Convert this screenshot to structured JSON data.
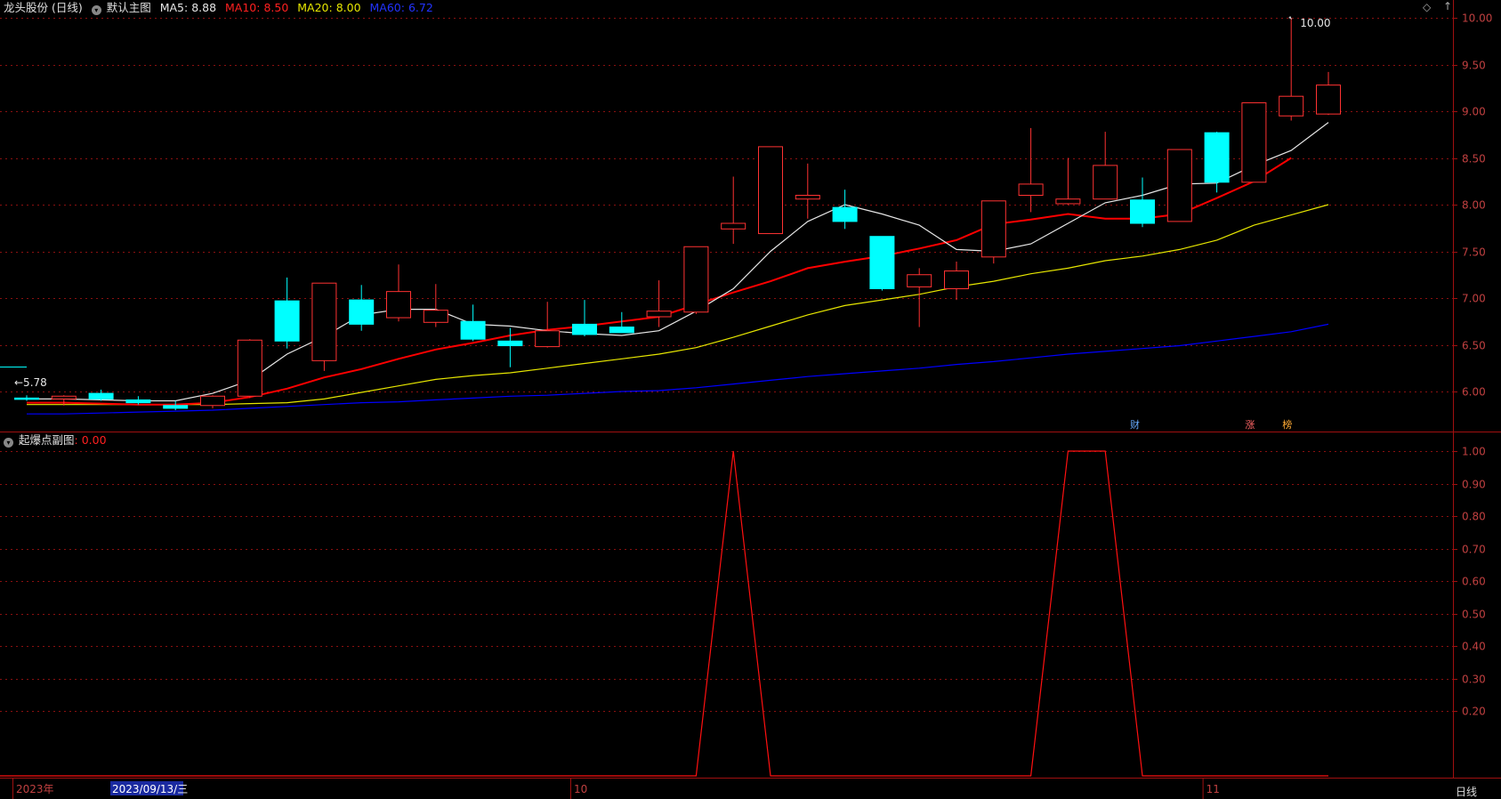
{
  "header": {
    "stock_name": "龙头股份 (日线)",
    "main_chart_label": "默认主图",
    "ma5": "MA5: 8.88",
    "ma10": "MA10: 8.50",
    "ma20": "MA20: 8.00",
    "ma60": "MA60: 6.72",
    "settings_icon": "diamond-icon"
  },
  "sub_header": {
    "label": "起爆点副图",
    "value": ": 0.00"
  },
  "colors": {
    "bg": "#000000",
    "up": "#ff3232",
    "down": "#00ffff",
    "ma5": "#e6e6e6",
    "ma10": "#ff0000",
    "ma20": "#e6e600",
    "ma60": "#0000ff",
    "grid": "#8a1010",
    "axis_text": "#c04040",
    "sub_line": "#ff1010"
  },
  "chart_data": [
    {
      "type": "candlestick",
      "ylim": [
        5.55,
        10.2
      ],
      "y_ticks": [
        "10.00",
        "9.50",
        "9.00",
        "8.50",
        "8.00",
        "7.50",
        "7.00",
        "6.50",
        "6.00"
      ],
      "ohlc": [
        [
          5.93,
          5.96,
          5.9,
          5.92
        ],
        [
          5.92,
          5.96,
          5.85,
          5.95
        ],
        [
          5.98,
          6.02,
          5.9,
          5.92
        ],
        [
          5.91,
          5.95,
          5.86,
          5.88
        ],
        [
          5.85,
          5.9,
          5.8,
          5.82
        ],
        [
          5.85,
          5.96,
          5.82,
          5.95
        ],
        [
          5.95,
          6.56,
          5.93,
          6.55
        ],
        [
          6.97,
          7.22,
          6.46,
          6.54
        ],
        [
          6.33,
          7.16,
          6.22,
          7.16
        ],
        [
          6.98,
          7.14,
          6.65,
          6.72
        ],
        [
          6.79,
          7.36,
          6.75,
          7.07
        ],
        [
          6.74,
          7.15,
          6.69,
          6.87
        ],
        [
          6.75,
          6.93,
          6.54,
          6.56
        ],
        [
          6.54,
          6.68,
          6.26,
          6.49
        ],
        [
          6.48,
          6.96,
          6.47,
          6.65
        ],
        [
          6.72,
          6.98,
          6.59,
          6.61
        ],
        [
          6.69,
          6.85,
          6.65,
          6.63
        ],
        [
          6.8,
          7.19,
          6.69,
          6.86
        ],
        [
          6.85,
          7.55,
          6.83,
          7.55
        ],
        [
          7.74,
          8.3,
          7.58,
          7.8
        ],
        [
          7.69,
          8.62,
          7.69,
          8.62
        ],
        [
          8.06,
          8.44,
          7.85,
          8.1
        ],
        [
          7.97,
          8.16,
          7.74,
          7.82
        ],
        [
          7.66,
          7.66,
          7.08,
          7.1
        ],
        [
          7.12,
          7.32,
          6.69,
          7.25
        ],
        [
          7.1,
          7.39,
          6.98,
          7.29
        ],
        [
          7.44,
          8.04,
          7.37,
          8.04
        ],
        [
          8.1,
          8.82,
          7.92,
          8.22
        ],
        [
          8.01,
          8.5,
          8.0,
          8.06
        ],
        [
          8.06,
          8.78,
          8.06,
          8.42
        ],
        [
          8.05,
          8.29,
          7.76,
          7.8
        ],
        [
          7.82,
          8.59,
          7.82,
          8.59
        ],
        [
          8.77,
          8.78,
          8.13,
          8.24
        ],
        [
          8.24,
          9.07,
          8.24,
          9.09
        ],
        [
          8.95,
          10.0,
          8.9,
          9.16
        ],
        [
          8.97,
          9.42,
          8.96,
          9.28
        ]
      ],
      "ma5": [
        5.92,
        5.92,
        5.91,
        5.9,
        5.9,
        5.98,
        6.12,
        6.4,
        6.59,
        6.82,
        6.88,
        6.88,
        6.72,
        6.7,
        6.65,
        6.62,
        6.6,
        6.65,
        6.86,
        7.1,
        7.5,
        7.82,
        8.0,
        7.9,
        7.78,
        7.52,
        7.5,
        7.58,
        7.8,
        8.02,
        8.1,
        8.22,
        8.23,
        8.42,
        8.58,
        8.88
      ],
      "ma10": [
        5.88,
        5.88,
        5.87,
        5.86,
        5.86,
        5.88,
        5.94,
        6.03,
        6.15,
        6.24,
        6.35,
        6.45,
        6.52,
        6.6,
        6.66,
        6.7,
        6.75,
        6.8,
        6.93,
        7.06,
        7.18,
        7.32,
        7.39,
        7.45,
        7.53,
        7.62,
        7.79,
        7.84,
        7.9,
        7.85,
        7.85,
        7.9,
        8.07,
        8.25,
        8.5
      ],
      "ma20": [
        5.86,
        5.86,
        5.86,
        5.86,
        5.86,
        5.86,
        5.87,
        5.88,
        5.92,
        5.99,
        6.06,
        6.13,
        6.17,
        6.2,
        6.25,
        6.3,
        6.35,
        6.4,
        6.47,
        6.58,
        6.7,
        6.82,
        6.92,
        6.98,
        7.04,
        7.12,
        7.18,
        7.26,
        7.32,
        7.4,
        7.45,
        7.52,
        7.62,
        7.78,
        7.89,
        8.0
      ],
      "ma60": [
        5.76,
        5.76,
        5.77,
        5.78,
        5.79,
        5.8,
        5.82,
        5.84,
        5.86,
        5.88,
        5.89,
        5.91,
        5.93,
        5.95,
        5.96,
        5.98,
        6.0,
        6.01,
        6.04,
        6.08,
        6.12,
        6.16,
        6.19,
        6.22,
        6.25,
        6.29,
        6.32,
        6.36,
        6.4,
        6.43,
        6.46,
        6.49,
        6.54,
        6.59,
        6.64,
        6.72
      ],
      "annotations": {
        "high_label": "10.00",
        "low_label": "5.78",
        "badges": [
          {
            "text": "财",
            "index": 30,
            "color": "#66aaff"
          },
          {
            "text": "涨",
            "index": 33,
            "color": "#ff6666"
          },
          {
            "text": "榜",
            "index": 34,
            "color": "#ffaa33"
          }
        ]
      }
    },
    {
      "type": "line",
      "title": "起爆点副图",
      "ylim": [
        0,
        1.05
      ],
      "y_ticks": [
        "1.00",
        "0.90",
        "0.80",
        "0.70",
        "0.60",
        "0.50",
        "0.40",
        "0.30",
        "0.20"
      ],
      "values": [
        0,
        0,
        0,
        0,
        0,
        0,
        0,
        0,
        0,
        0,
        0,
        0,
        0,
        0,
        0,
        0,
        0,
        0,
        0,
        1,
        0,
        0,
        0,
        0,
        0,
        0,
        0,
        0,
        1,
        1,
        0,
        0,
        0,
        0,
        0,
        0
      ]
    }
  ],
  "x_axis": {
    "labels": [
      {
        "text": "2023年",
        "index": 0
      },
      {
        "text": "2023/09/13/三",
        "index": 3,
        "highlight": true
      },
      {
        "text": "10",
        "index": 15
      },
      {
        "text": "11",
        "index": 32
      }
    ],
    "period_label": "日线"
  }
}
